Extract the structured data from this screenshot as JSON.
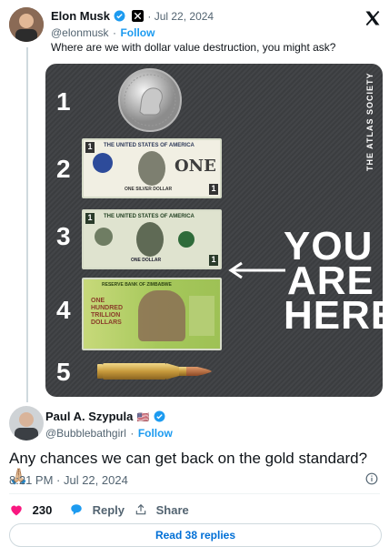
{
  "quoted": {
    "name": "Elon Musk",
    "handle": "@elonmusk",
    "dot": "·",
    "follow": "Follow",
    "date": "· Jul 22, 2024",
    "text": "Where are we with dollar value destruction, you might ask?"
  },
  "image": {
    "numbers": [
      "1",
      "2",
      "3",
      "4",
      "5"
    ],
    "side_brand": "THE ATLAS SOCIETY",
    "you": "YOU",
    "are": "ARE",
    "here": "HERE",
    "bill2_top": "THE UNITED STATES OF AMERICA",
    "bill2_one": "ONE",
    "bill2_bottom": "ONE SILVER DOLLAR",
    "bill3_top": "THE UNITED STATES OF AMERICA",
    "bill3_bottom": "ONE DOLLAR",
    "bill4_top": "RESERVE BANK OF ZIMBABWE",
    "bill4_amount": "ONE HUNDRED TRILLION DOLLARS"
  },
  "reply": {
    "name": "Paul A. Szypula",
    "flag": "🇺🇸",
    "handle": "@Bubblebathgirl",
    "dot": "·",
    "follow": "Follow",
    "text": "Any chances we can get back on the gold standard? 🙏🏼",
    "time": "8:21 PM · Jul 22, 2024",
    "likes": "230",
    "reply_label": "Reply",
    "share_label": "Share",
    "read_replies": "Read 38 replies"
  },
  "colors": {
    "accent": "#1d9bf0",
    "like": "#f91880",
    "card_bg": "#3d3f42"
  }
}
